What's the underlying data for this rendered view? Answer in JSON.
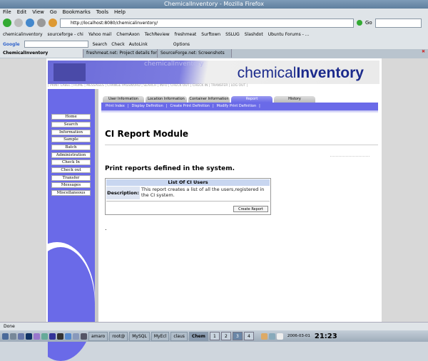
{
  "window": {
    "title": "ChemicalInventory - Mozilla Firefox"
  },
  "menu": [
    "File",
    "Edit",
    "View",
    "Go",
    "Bookmarks",
    "Tools",
    "Help"
  ],
  "nav": {
    "url": "http://localhost:8080/chemicalinventory/",
    "go_label": "Go"
  },
  "bookmarks": [
    "chemicalinventory",
    "sourceforge - chi",
    "Yahoo mail",
    "ChemAxon",
    "TechReview",
    "freshmeat",
    "Surftown",
    "SSLUG",
    "Slashdot",
    "Ubuntu Forums - ..."
  ],
  "googlebar": {
    "logo": "Google",
    "search": "Search",
    "check": "Check",
    "autolink": "AutoLink",
    "options": "Options"
  },
  "browser_tabs": [
    "ChemicalInventory",
    "freshmeat.net: Project details for...",
    "SourceForge.net: Screenshots"
  ],
  "banner": {
    "logo_regular": "chemical",
    "logo_bold": "Inventory",
    "ghost": "chemicalInventory"
  },
  "toplinks": "| PRINT LABEL | HOME | MESSAGES | CHANGE PASSWORD | SEARCH | INFO | CHECK OUT | CHECK IN | TRANSFER | LOG OUT |",
  "sidebar": [
    "Home",
    "Search",
    "Information",
    "Sample",
    "Batch",
    "Administration",
    "Check In",
    "Check out",
    "Transfer",
    "Messages",
    "Miscellaneous"
  ],
  "content_tabs": [
    "User Information",
    "Location Information",
    "Container Information",
    "Report",
    "History"
  ],
  "subnav": [
    "Print Index",
    "Display Definition",
    "Create Print Definition",
    "Modify Print Definition"
  ],
  "main": {
    "title": "CI Report Module",
    "subtitle": "Print reports defined in the system.",
    "report": {
      "name": "List Of CI Users",
      "desc_label": "Description:",
      "description": "This report creates a list of all the users,registered in the CI system.",
      "button": "Create Report"
    },
    "footer_dot": "."
  },
  "status": "Done",
  "taskbar": {
    "tasks": [
      "amaro",
      "root@",
      "MySQL",
      "MyEcl",
      "claus",
      "Chem"
    ],
    "desktops": [
      "1",
      "2",
      "3",
      "4"
    ],
    "date": "2006-03-01",
    "time": "21:23"
  }
}
